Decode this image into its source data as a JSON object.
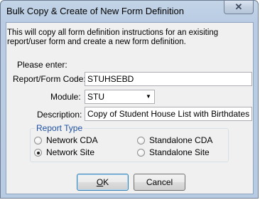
{
  "window": {
    "title": "Bulk Copy & Create of New Form Definition",
    "close_glyph": "✕"
  },
  "dialog": {
    "intro": "This will copy all form definition instructions for an exisiting report/user form and create a new form definition.",
    "please_enter": "Please enter:",
    "fields": {
      "code_label": "Report/Form Code:",
      "code_value": "STUHSEBD",
      "module_label": "Module:",
      "module_value": "STU",
      "description_label": "Description:",
      "description_value": "Copy of Student House List with Birthdates"
    },
    "report_type": {
      "legend": "Report Type",
      "options": [
        {
          "label": "Network CDA",
          "checked": false
        },
        {
          "label": "Standalone CDA",
          "checked": false
        },
        {
          "label": "Network Site",
          "checked": true
        },
        {
          "label": "Standalone Site",
          "checked": false
        }
      ]
    },
    "buttons": {
      "ok_label": "OK",
      "cancel_label": "Cancel"
    }
  }
}
